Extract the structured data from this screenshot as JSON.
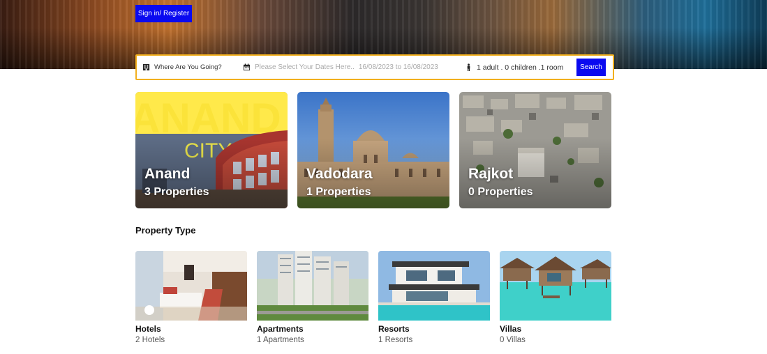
{
  "header": {
    "signin_label": "Sign in/ Register"
  },
  "search": {
    "where_label": "Where Are You Going?",
    "dates_placeholder": "Please Select Your Dates Here..",
    "dates_value": "16/08/2023 to 16/08/2023",
    "guests_value": "1 adult . 0 children .1 room",
    "button_label": "Search"
  },
  "cities": [
    {
      "name": "Anand",
      "count": "3 Properties"
    },
    {
      "name": "Vadodara",
      "count": "1 Properties"
    },
    {
      "name": "Rajkot",
      "count": "0 Properties"
    }
  ],
  "property_section": {
    "title": "Property Type",
    "types": [
      {
        "name": "Hotels",
        "count": "2 Hotels"
      },
      {
        "name": "Apartments",
        "count": "1 Apartments"
      },
      {
        "name": "Resorts",
        "count": "1 Resorts"
      },
      {
        "name": "Villas",
        "count": "0 Villas"
      }
    ]
  },
  "colors": {
    "accent_blue": "#0a0af0",
    "search_border": "#f2b01e"
  },
  "icons": {
    "where": "building-icon",
    "dates": "calendar-icon",
    "guests": "person-icon"
  }
}
